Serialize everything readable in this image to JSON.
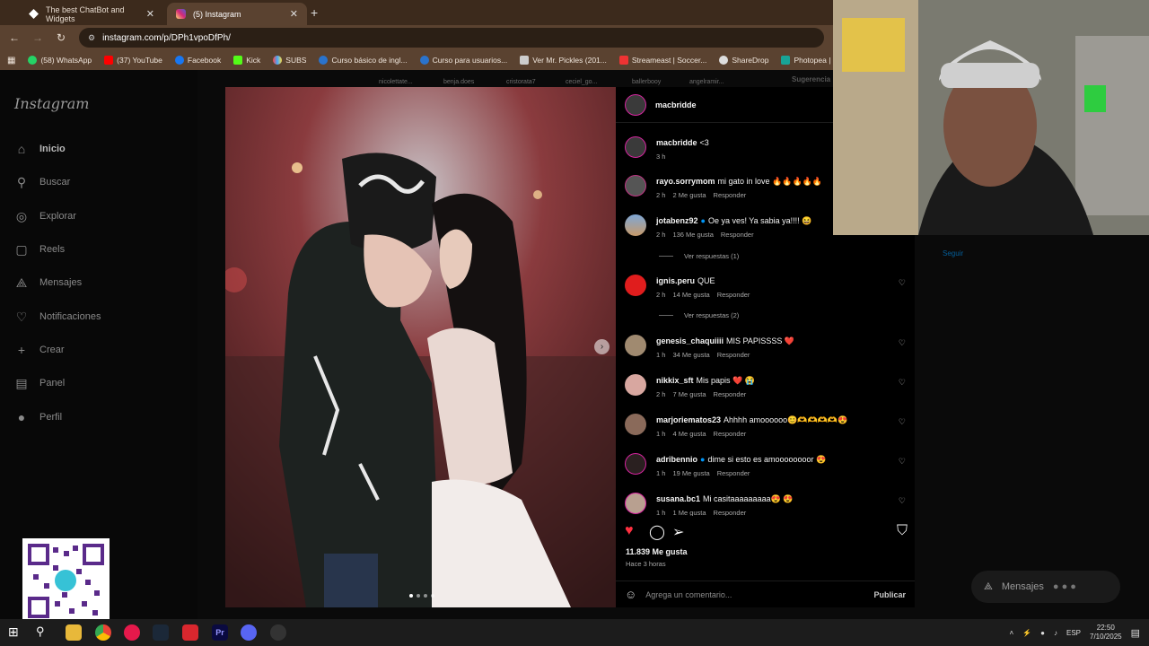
{
  "browser": {
    "tabs": [
      {
        "title": "The best ChatBot and Widgets",
        "active": false
      },
      {
        "title": "(5) Instagram",
        "active": true
      }
    ],
    "url": "instagram.com/p/DPh1vpoDfPh/",
    "bookmarks": [
      "(58) WhatsApp",
      "(37) YouTube",
      "Facebook",
      "Kick",
      "SUBS",
      "Curso básico de ingl...",
      "Curso para usuarios...",
      "Ver Mr. Pickles (201...",
      "Streameast | Soccer...",
      "ShareDrop",
      "Photopea | Online P..."
    ]
  },
  "sidebar": {
    "logo": "Instagram",
    "items": [
      {
        "label": "Inicio",
        "icon": "home-icon"
      },
      {
        "label": "Buscar",
        "icon": "search-icon"
      },
      {
        "label": "Explorar",
        "icon": "compass-icon"
      },
      {
        "label": "Reels",
        "icon": "reels-icon"
      },
      {
        "label": "Mensajes",
        "icon": "messenger-icon"
      },
      {
        "label": "Notificaciones",
        "icon": "heart-icon"
      },
      {
        "label": "Crear",
        "icon": "plus-icon"
      },
      {
        "label": "Panel",
        "icon": "dashboard-icon"
      },
      {
        "label": "Perfil",
        "icon": "profile-icon"
      }
    ]
  },
  "stories": [
    "nicolettate...",
    "benja.does",
    "cristorata7",
    "ceciel_go...",
    "ballerbooy",
    "angelramir..."
  ],
  "suggestions_label": "Sugerencia",
  "post": {
    "author": "macbridde",
    "comments": [
      {
        "user": "macbridde",
        "text": "<3",
        "time": "3 h",
        "likes": "",
        "reply": ""
      },
      {
        "user": "rayo.sorrymom",
        "text": "mi gato in love 🔥🔥🔥🔥🔥",
        "time": "2 h",
        "likes": "2 Me gusta",
        "reply": "Responder"
      },
      {
        "user": "jotabenz92",
        "text": "Oe ya ves! Ya sabia ya!!!! 😆",
        "time": "2 h",
        "likes": "136 Me gusta",
        "reply": "Responder"
      },
      {
        "user": "ignis.peru",
        "text": "QUE",
        "time": "2 h",
        "likes": "14 Me gusta",
        "reply": "Responder"
      },
      {
        "user": "genesis_chaquiiii",
        "text": "MIS PAPISSSS ❤️",
        "time": "1 h",
        "likes": "34 Me gusta",
        "reply": "Responder"
      },
      {
        "user": "nikkix_sft",
        "text": "Mis papis ❤️ 😭",
        "time": "2 h",
        "likes": "7 Me gusta",
        "reply": "Responder"
      },
      {
        "user": "marjoriematos23",
        "text": "Ahhhh amoooooo😊🫶🫶🫶🫶😍",
        "time": "1 h",
        "likes": "4 Me gusta",
        "reply": "Responder"
      },
      {
        "user": "adribennio",
        "text": "dime si esto es amoooooooor 😍",
        "time": "1 h",
        "likes": "19 Me gusta",
        "reply": "Responder"
      },
      {
        "user": "susana.bc1",
        "text": "Mi casitaaaaaaaaa😍 😍",
        "time": "1 h",
        "likes": "1 Me gusta",
        "reply": "Responder"
      }
    ],
    "replies_1": "Ver respuestas (1)",
    "replies_2": "Ver respuestas (2)",
    "like_count": "11.839 Me gusta",
    "posted": "Hace 3 horas",
    "comment_placeholder": "Agrega un comentario...",
    "publish": "Publicar"
  },
  "right": {
    "follow": "Seguir",
    "messages": "Mensajes"
  },
  "taskbar": {
    "lang": "ESP",
    "time": "22:50",
    "date": "7/10/2025"
  },
  "colors": {
    "tab_bar": "#3c2a1c",
    "toolbar": "#5a4230",
    "instagram_bg": "#000000",
    "like_red": "#ff3040"
  }
}
